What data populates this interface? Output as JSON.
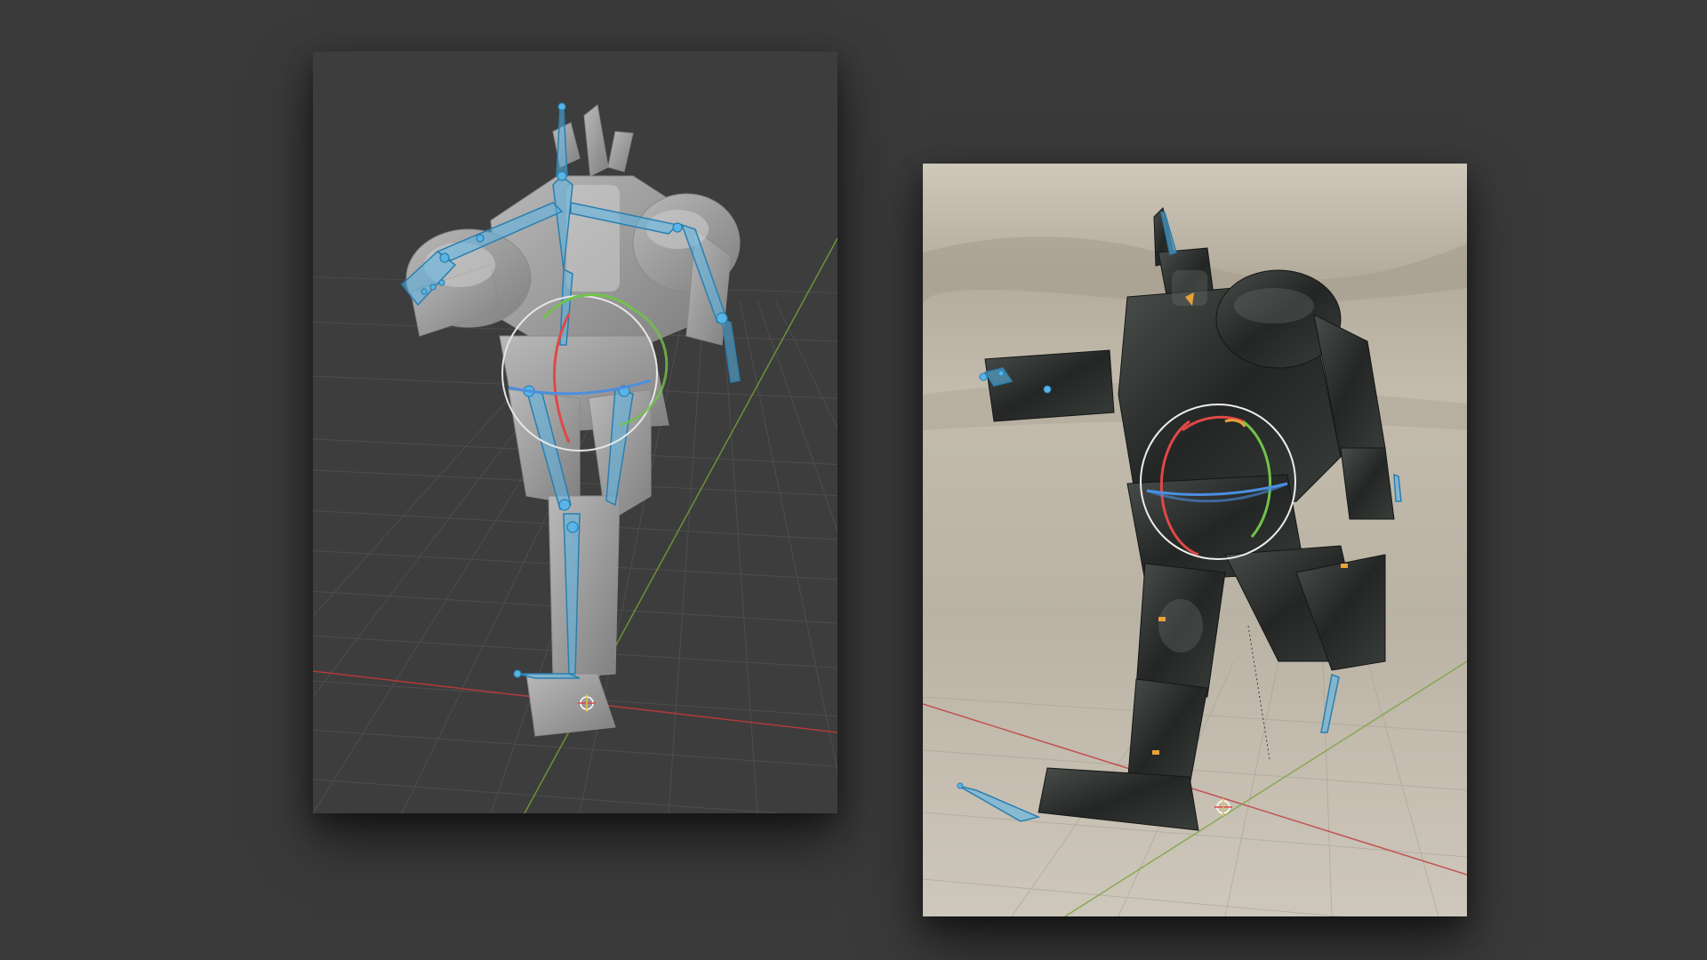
{
  "colors": {
    "background": "#3a3a3a",
    "viewport_dark": "#3d3d3d",
    "grid_line": "#4a4a4a",
    "axis_x": "#c0393b",
    "axis_y": "#7aa33a",
    "bone": "#5ab4e6",
    "bone_outline": "#2a7fb0",
    "gizmo_ring": "#e6e6e6",
    "gizmo_x": "#e04848",
    "gizmo_y": "#72c24a",
    "gizmo_z": "#4a8fe0",
    "robot_clay": "#9a9a9a",
    "robot_metal": "#2b2e2c",
    "ground_sand": "#c2bbae"
  },
  "viewports": [
    {
      "name": "pose-viewport-solid",
      "shading": "solid",
      "icons": [
        "armature-icon",
        "rotation-gizmo-icon",
        "origin-icon"
      ]
    },
    {
      "name": "pose-viewport-rendered",
      "shading": "rendered",
      "icons": [
        "armature-icon",
        "rotation-gizmo-icon",
        "origin-icon"
      ]
    }
  ]
}
